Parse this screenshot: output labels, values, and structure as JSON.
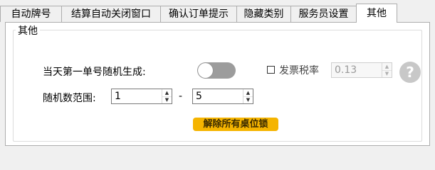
{
  "tabs": [
    {
      "label": "自动牌号",
      "active": false
    },
    {
      "label": "结算自动关闭窗口",
      "active": false
    },
    {
      "label": "确认订单提示",
      "active": false
    },
    {
      "label": "隐藏类别",
      "active": false
    },
    {
      "label": "服务员设置",
      "active": false
    },
    {
      "label": "其他",
      "active": true
    }
  ],
  "group": {
    "title": "其他"
  },
  "random_first_order": {
    "label": "当天第一单号随机生成:",
    "enabled": false
  },
  "invoice_tax": {
    "label": "发票税率",
    "checked": false,
    "value": "0.13"
  },
  "random_range": {
    "label": "随机数范围:",
    "min": "1",
    "separator": "-",
    "max": "5"
  },
  "help": {
    "glyph": "?"
  },
  "unlock_button": {
    "label": "解除所有桌位锁"
  },
  "colors": {
    "button": "#f5b400",
    "toggle_off": "#9c9c9c"
  }
}
